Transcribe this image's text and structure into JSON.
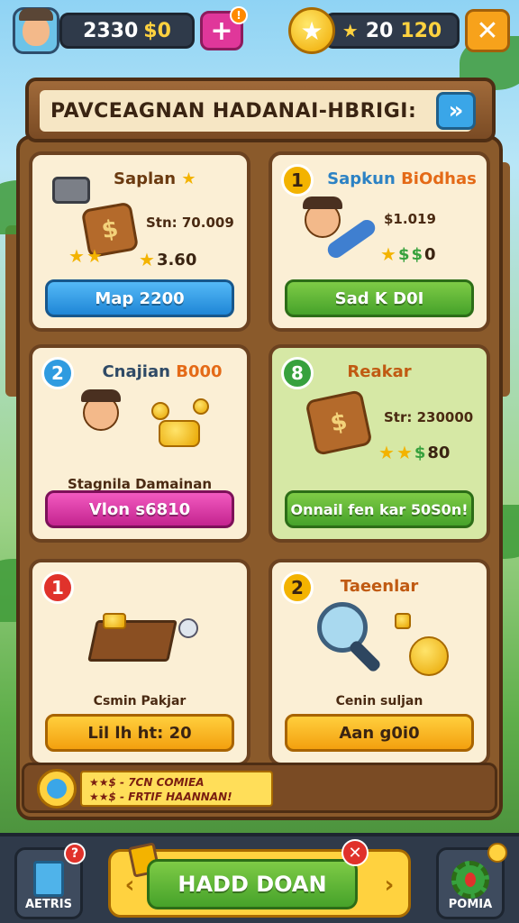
{
  "topbar": {
    "coins_a": "2330",
    "coins_b": "$0",
    "plus_label": "+",
    "plus_badge": "!",
    "gems_a": "20",
    "gems_b": "120",
    "close_label": "✕"
  },
  "title": {
    "text": "PAVCEAGNAN HADANAI-HBRIGI:",
    "arrow": "»"
  },
  "cards": [
    {
      "badge": "",
      "title": "Saplan",
      "price": "Stn: 70.009",
      "rating": "3.60",
      "button": "Map 2200"
    },
    {
      "badge": "1",
      "title_a": "Sapkun",
      "title_b": "BiOdhas",
      "price": "$1.019",
      "rating": "0",
      "button": "Sad K D0I"
    },
    {
      "badge": "2",
      "title_a": "Cnajian",
      "title_b": "B000",
      "subtitle": "Stagnila Damainan",
      "button": "Vlon s6810"
    },
    {
      "badge": "8",
      "title": "Reakar",
      "price": "Str: 230000",
      "rating": "80",
      "button": "Onnail fen kar 50S0n!"
    },
    {
      "badge": "1",
      "subtitle": "Csmin Pakjar",
      "button": "Lil lh ht: 20"
    },
    {
      "badge": "2",
      "title": "Taeenlar",
      "subtitle": "Cenin suljan",
      "button": "Aan g0i0"
    }
  ],
  "tip": {
    "line1": "★★$ - 7CN COMIEA",
    "line2": "★★$ - FRTIF HAANNAN!"
  },
  "bottom": {
    "left_label": "AETRIS",
    "left_badge": "?",
    "main_label": "HADD DOAN",
    "close_badge": "✕",
    "right_label": "POMIA"
  }
}
